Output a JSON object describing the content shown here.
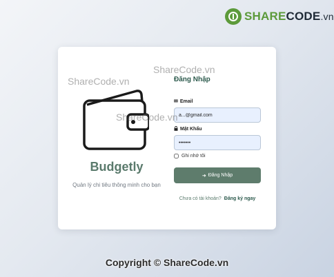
{
  "watermark_logo": {
    "share": "SHARE",
    "code": "CODE",
    "vn": ".vn"
  },
  "watermarks": [
    "ShareCode.vn",
    "ShareCode.vn",
    "ShareCode.vn"
  ],
  "brand": {
    "name": "Budgetly",
    "tagline": "Quản lý chi tiêu thông minh cho bạn",
    "icon": "wallet-icon"
  },
  "login": {
    "title": "Đăng Nhập",
    "email_label": "Email",
    "email_icon": "envelope-icon",
    "email_value": "a...@gmail.com",
    "password_label": "Mật Khẩu",
    "password_icon": "lock-icon",
    "password_value": "•••••••",
    "remember_label": "Ghi nhớ tôi",
    "submit_label": "Đăng Nhập",
    "submit_icon": "sign-in-icon",
    "register_prompt": "Chưa có tài khoản?",
    "register_link": "Đăng ký ngay"
  },
  "footer": "Copyright © ShareCode.vn",
  "colors": {
    "primary": "#5e7c6c",
    "heading": "#2d5a4d",
    "input_bg": "#e8f0fe",
    "logo_green": "#5c9a3a"
  }
}
